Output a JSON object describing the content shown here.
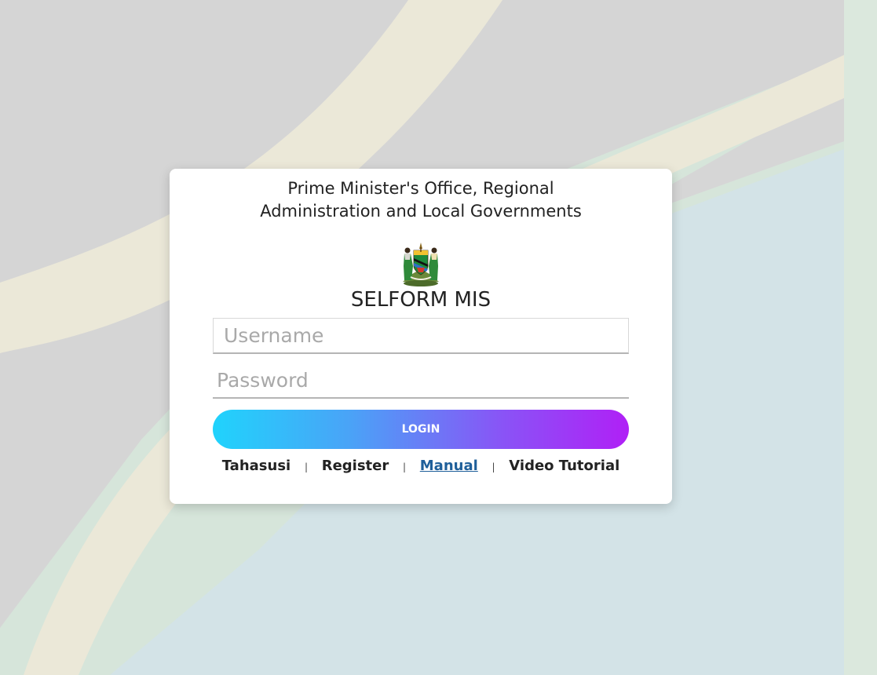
{
  "header": {
    "org_line1": "Prime Minister's Office, Regional",
    "org_line2": "Administration and Local Governments",
    "app_name": "SELFORM MIS"
  },
  "icons": {
    "emblem": "tanzania-coat-of-arms-icon"
  },
  "login_form": {
    "username_placeholder": "Username",
    "password_placeholder": "Password",
    "username_value": "",
    "password_value": "",
    "login_label": "LOGIN"
  },
  "links": {
    "tahasusi": "Tahasusi",
    "register": "Register",
    "manual": "Manual",
    "video": "Video Tutorial",
    "separator": "|"
  },
  "colors": {
    "gradient_start": "#20d3fc",
    "gradient_end": "#b020f6",
    "manual_link": "#1f5f9a"
  }
}
